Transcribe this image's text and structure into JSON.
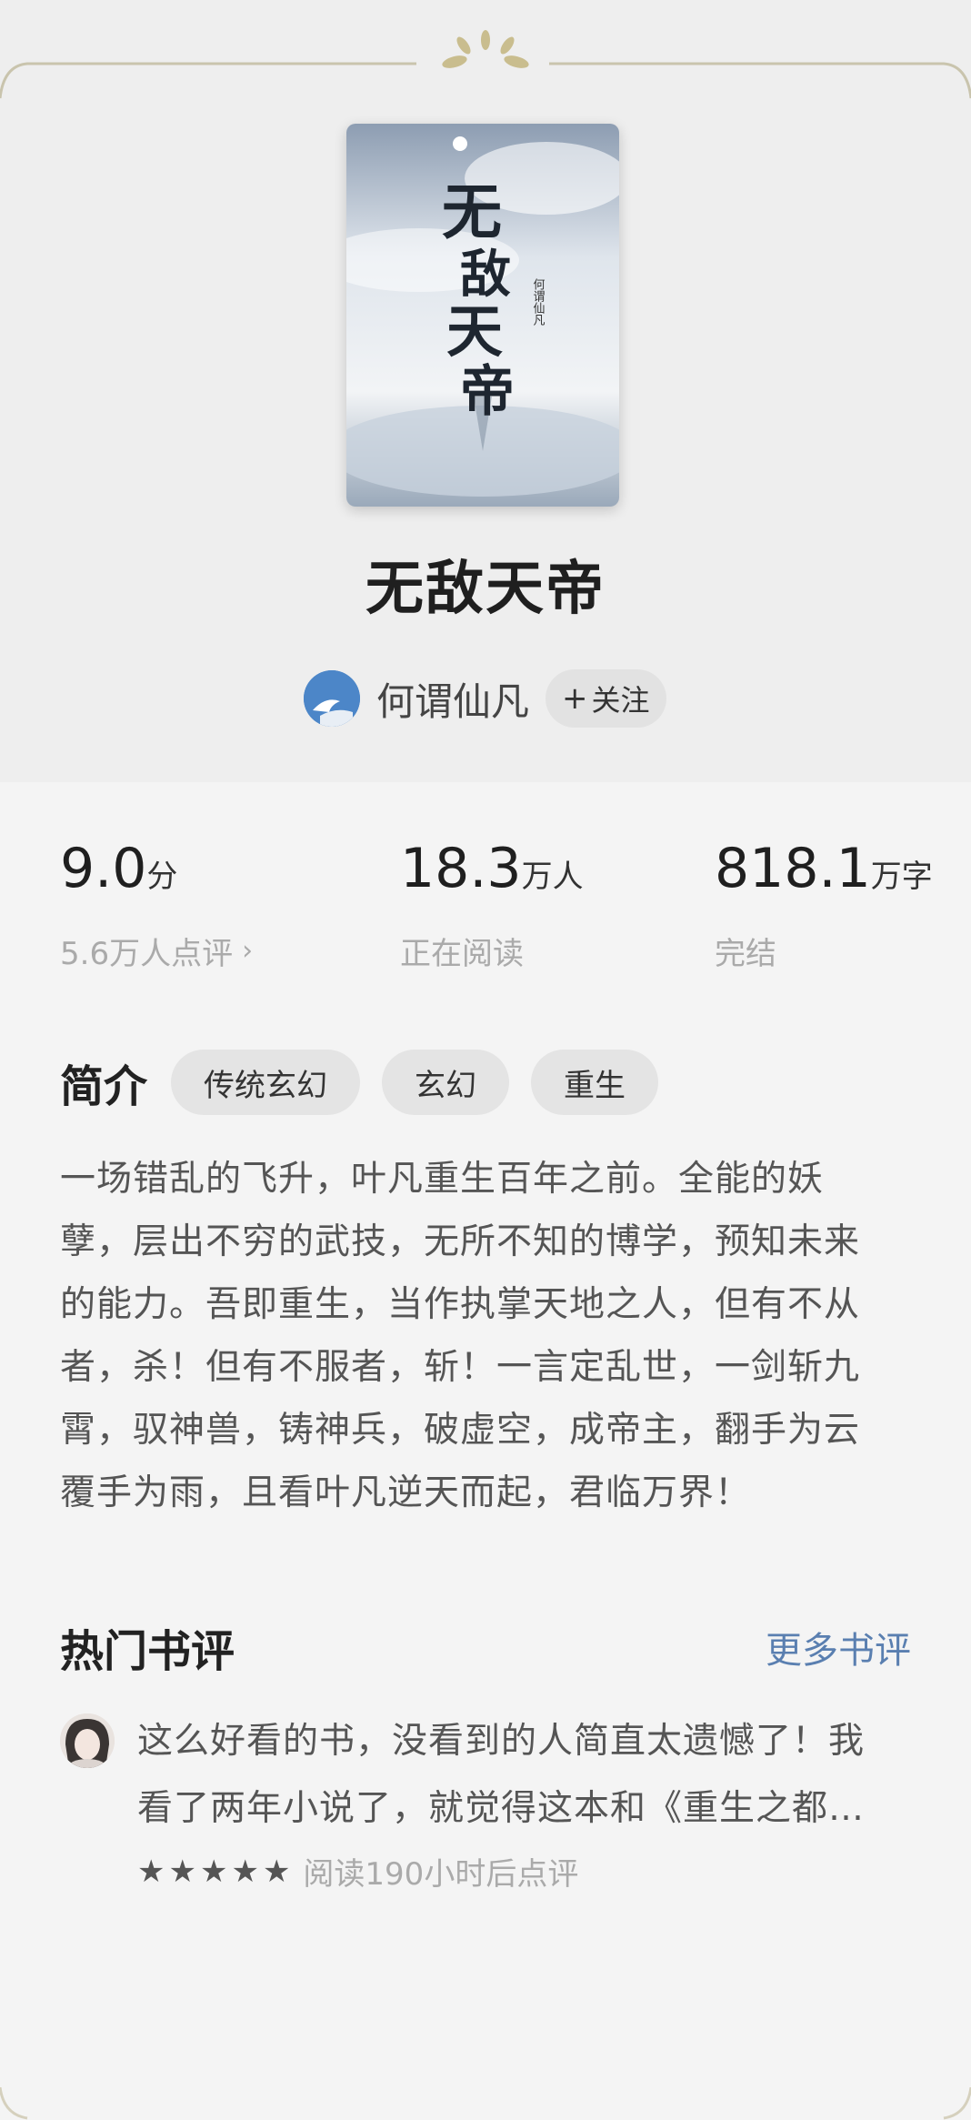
{
  "book": {
    "title": "无敌天帝",
    "author": "何谓仙凡",
    "follow_label": "关注",
    "follow_plus": "+",
    "cover_title": "无敌天帝",
    "cover_author": "何谓仙凡"
  },
  "stats": {
    "rating": {
      "value": "9.0",
      "unit": "分",
      "sub": "5.6万人点评"
    },
    "readers": {
      "value": "18.3",
      "unit": "万人",
      "sub": "正在阅读"
    },
    "words": {
      "value": "818.1",
      "unit": "万字",
      "sub": "完结"
    }
  },
  "intro": {
    "title": "简介",
    "tags": [
      "传统玄幻",
      "玄幻",
      "重生"
    ],
    "lines": [
      "一场错乱的飞升，叶凡重生百年之前。全能的妖",
      "孽，层出不穷的武技，无所不知的博学，预知未来",
      "的能力。吾即重生，当作执掌天地之人，但有不从",
      "者，杀！但有不服者，斩！一言定乱世，一剑斩九",
      "霄，驭神兽，铸神兵，破虚空，成帝主，翻手为云",
      "覆手为雨，且看叶凡逆天而起，君临万界！"
    ]
  },
  "reviews": {
    "title": "热门书评",
    "more_label": "更多书评",
    "items": [
      {
        "line1": "这么好看的书，没看到的人简直太遗憾了！我",
        "line2": "看了两年小说了，就觉得这本和《重生之都…",
        "stars": 5,
        "note": "阅读190小时后点评"
      }
    ]
  },
  "colors": {
    "accent_link": "#5a7fb0",
    "ornament": "#c9bd8e"
  }
}
